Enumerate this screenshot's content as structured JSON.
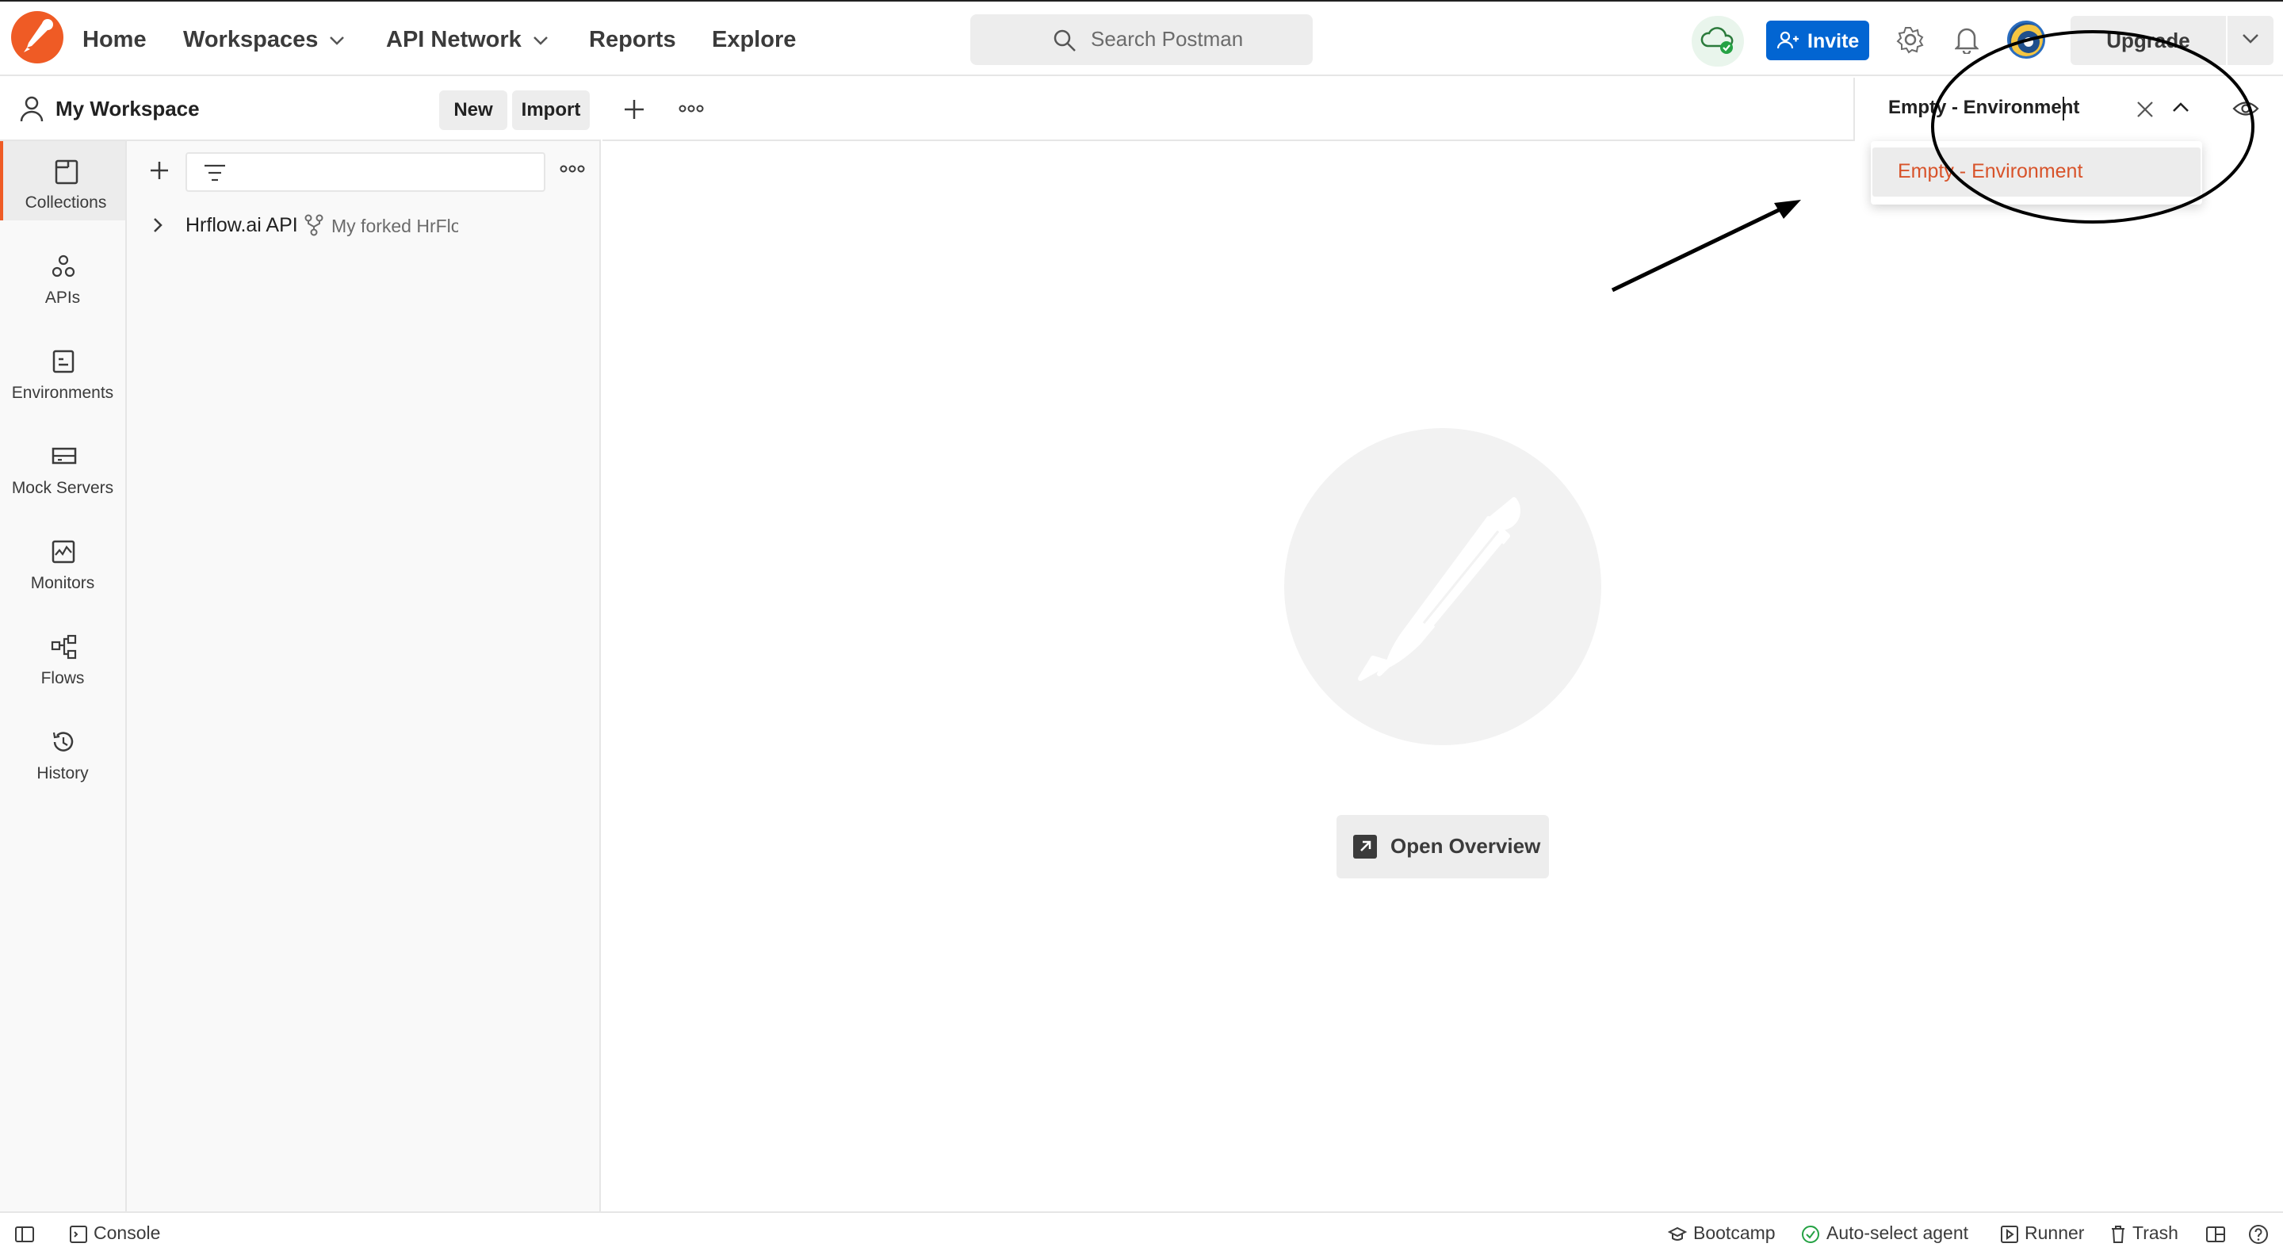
{
  "header": {
    "nav": {
      "home": "Home",
      "workspaces": "Workspaces",
      "api_network": "API Network",
      "reports": "Reports",
      "explore": "Explore"
    },
    "search_placeholder": "Search Postman",
    "invite_label": "Invite",
    "upgrade_label": "Upgrade",
    "icons": [
      "postman-logo-icon",
      "cloud-sync-icon",
      "settings-icon",
      "bell-icon",
      "avatar"
    ]
  },
  "workspace": {
    "name": "My Workspace",
    "new_label": "New",
    "import_label": "Import"
  },
  "sidebar": {
    "items": [
      {
        "label": "Collections",
        "icon": "collections-icon",
        "active": true
      },
      {
        "label": "APIs",
        "icon": "apis-icon",
        "active": false
      },
      {
        "label": "Environments",
        "icon": "environments-icon",
        "active": false
      },
      {
        "label": "Mock Servers",
        "icon": "mock-servers-icon",
        "active": false
      },
      {
        "label": "Monitors",
        "icon": "monitors-icon",
        "active": false
      },
      {
        "label": "Flows",
        "icon": "flows-icon",
        "active": false
      },
      {
        "label": "History",
        "icon": "history-icon",
        "active": false
      }
    ]
  },
  "collections": [
    {
      "name": "Hrflow.ai API",
      "fork_label": "My forked HrFlow.a"
    }
  ],
  "environment": {
    "input_value": "Empty - Environment",
    "options": [
      "Empty - Environment"
    ]
  },
  "main": {
    "open_overview_label": "Open Overview"
  },
  "statusbar": {
    "console": "Console",
    "bootcamp": "Bootcamp",
    "auto_select_agent": "Auto-select agent",
    "runner": "Runner",
    "trash": "Trash"
  },
  "colors": {
    "brand": "#ef5b25",
    "invite_blue": "#0265d2",
    "option_text": "#d8532a"
  }
}
